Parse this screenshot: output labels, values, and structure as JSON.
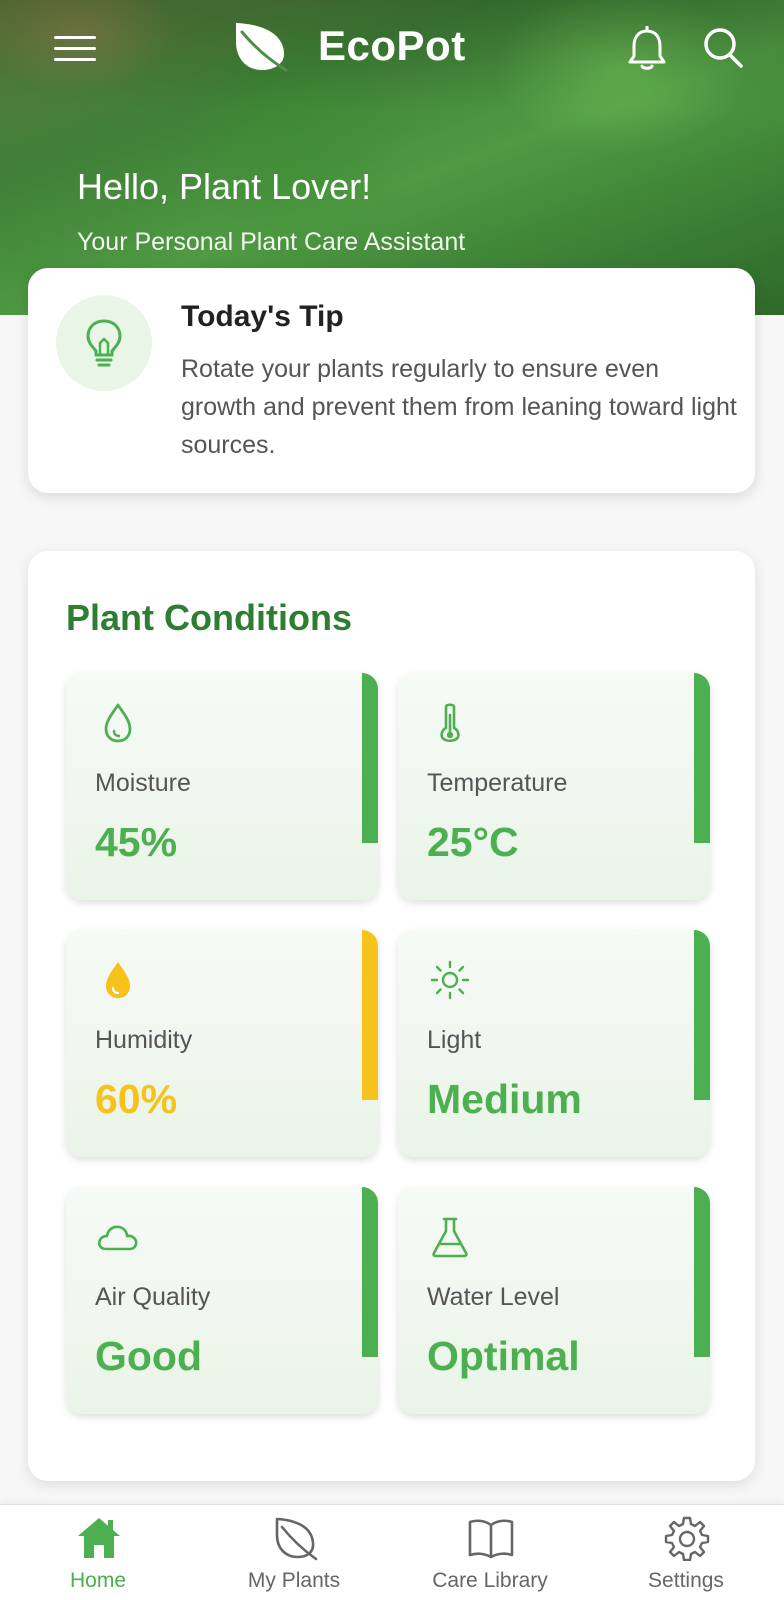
{
  "app": {
    "title": "EcoPot",
    "greeting": "Hello, Plant Lover!",
    "subtitle": "Your Personal Plant Care Assistant",
    "icons": {
      "menu": "hamburger-menu-icon",
      "logo": "leaf-icon",
      "notifications": "bell-icon",
      "search": "search-icon"
    }
  },
  "tip": {
    "title": "Today's Tip",
    "text": "Rotate your plants regularly to ensure even growth and prevent them from leaning toward light sources.",
    "icon": "lightbulb-icon"
  },
  "conditions": {
    "title": "Plant Conditions",
    "items": [
      {
        "label": "Moisture",
        "value": "45%",
        "icon": "water-drop-icon",
        "status": "good"
      },
      {
        "label": "Temperature",
        "value": "25°C",
        "icon": "thermometer-icon",
        "status": "good"
      },
      {
        "label": "Humidity",
        "value": "60%",
        "icon": "filled-drop-icon",
        "status": "warning"
      },
      {
        "label": "Light",
        "value": "Medium",
        "icon": "sun-icon",
        "status": "good"
      },
      {
        "label": "Air Quality",
        "value": "Good",
        "icon": "cloud-icon",
        "status": "good"
      },
      {
        "label": "Water Level",
        "value": "Optimal",
        "icon": "flask-icon",
        "status": "good"
      }
    ]
  },
  "nav": {
    "items": [
      {
        "label": "Home",
        "icon": "home-icon",
        "active": true
      },
      {
        "label": "My Plants",
        "icon": "leaf-icon",
        "active": false
      },
      {
        "label": "Care Library",
        "icon": "book-icon",
        "active": false
      },
      {
        "label": "Settings",
        "icon": "gear-icon",
        "active": false
      }
    ]
  },
  "colors": {
    "primary": "#4caf50",
    "primary_dark": "#2e7d32",
    "warning": "#f6c21c",
    "tip_circle": "#e8f5e7"
  }
}
